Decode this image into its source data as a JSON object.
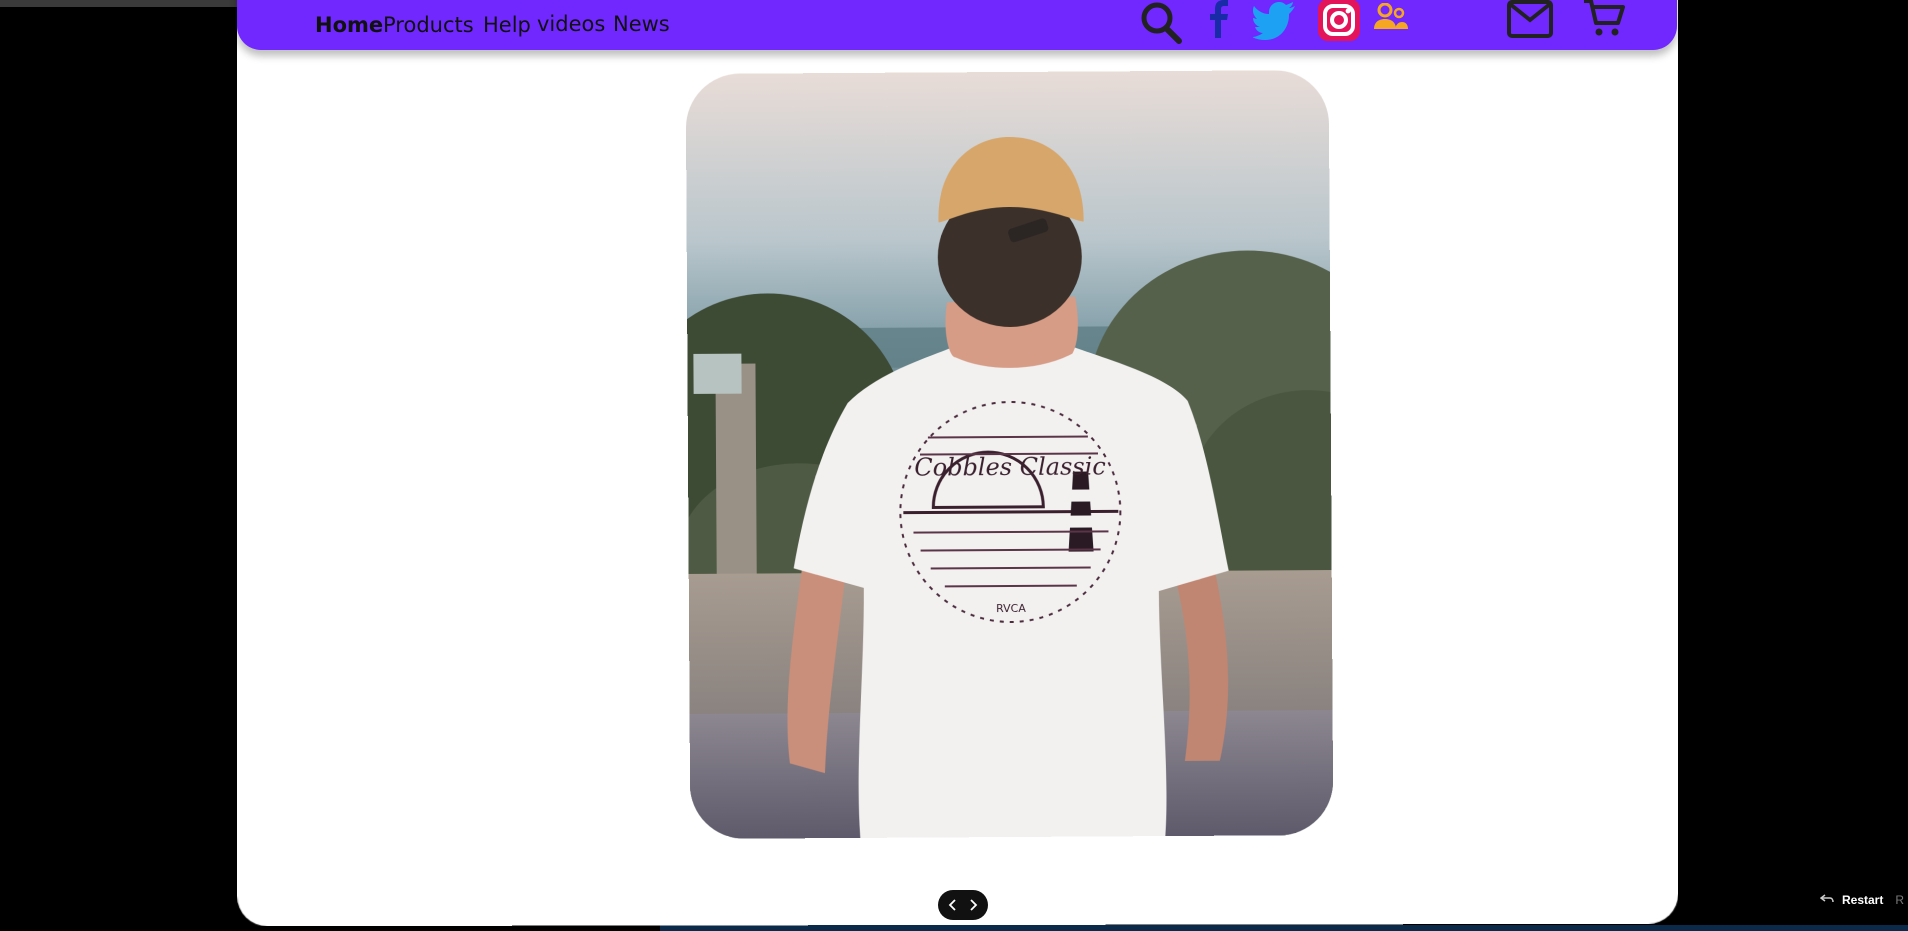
{
  "nav": {
    "links": [
      {
        "label": "Home",
        "active": true
      },
      {
        "label": "Products",
        "active": false
      },
      {
        "label": "Help",
        "active": false
      },
      {
        "label": "videos",
        "active": false
      },
      {
        "label": "News",
        "active": false
      }
    ],
    "icons": [
      "search-icon",
      "facebook-icon",
      "twitter-icon",
      "instagram-icon",
      "users-icon",
      "mail-icon",
      "cart-icon"
    ],
    "colors": {
      "bar": "#7028ff",
      "instagram": "#e4145a",
      "twitter": "#1da1f2",
      "users": "#f5a623"
    }
  },
  "slide": {
    "image": "man-in-white-tshirt-back-view",
    "shirt_print": "Cobbles Classic",
    "shirt_brand": "RVCA"
  },
  "slider": {
    "prev_icon": "chevron-left-icon",
    "next_icon": "chevron-right-icon"
  },
  "restart": {
    "label": "Restart",
    "key": "R"
  }
}
